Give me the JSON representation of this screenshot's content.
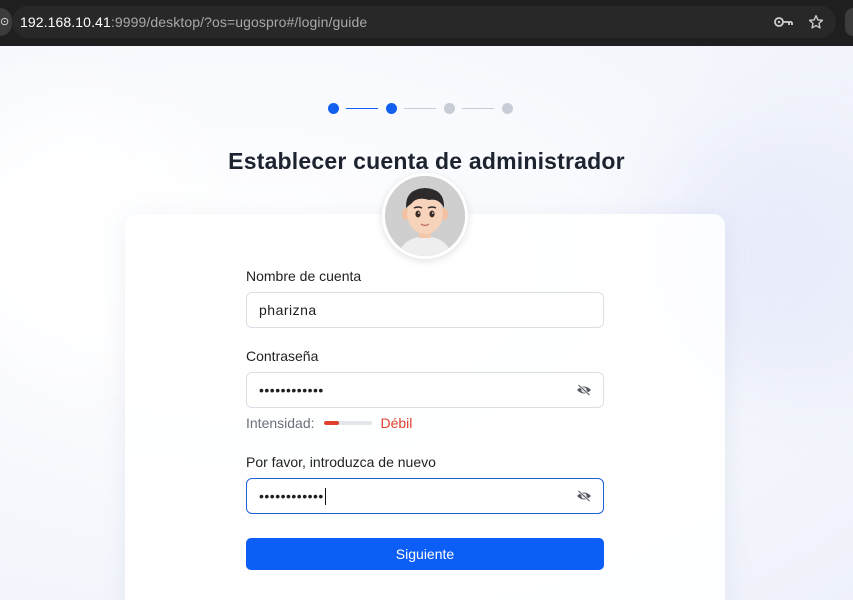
{
  "browser": {
    "url_host": "192.168.10.41",
    "url_rest": ":9999/desktop/?os=ugospro#/login/guide",
    "icons": [
      "site-info-icon",
      "password-key-icon",
      "bookmark-star-icon"
    ]
  },
  "stepper": {
    "total_steps": 4,
    "current_step": 2,
    "active_color": "#1360f0",
    "inactive_color": "#c8ccd4"
  },
  "page": {
    "title": "Establecer cuenta de administrador"
  },
  "form": {
    "account_label": "Nombre de cuenta",
    "account_value": "pharizna",
    "password_label": "Contraseña",
    "password_value": "••••••••••••",
    "strength_label": "Intensidad:",
    "strength_value": "Débil",
    "strength_level": 0.33,
    "confirm_label": "Por favor, introduzca de nuevo",
    "confirm_value": "••••••••••••",
    "next_button": "Siguiente"
  },
  "colors": {
    "primary": "#0c5ef6",
    "weak": "#e0402f",
    "focus_border": "#1d63d8"
  }
}
